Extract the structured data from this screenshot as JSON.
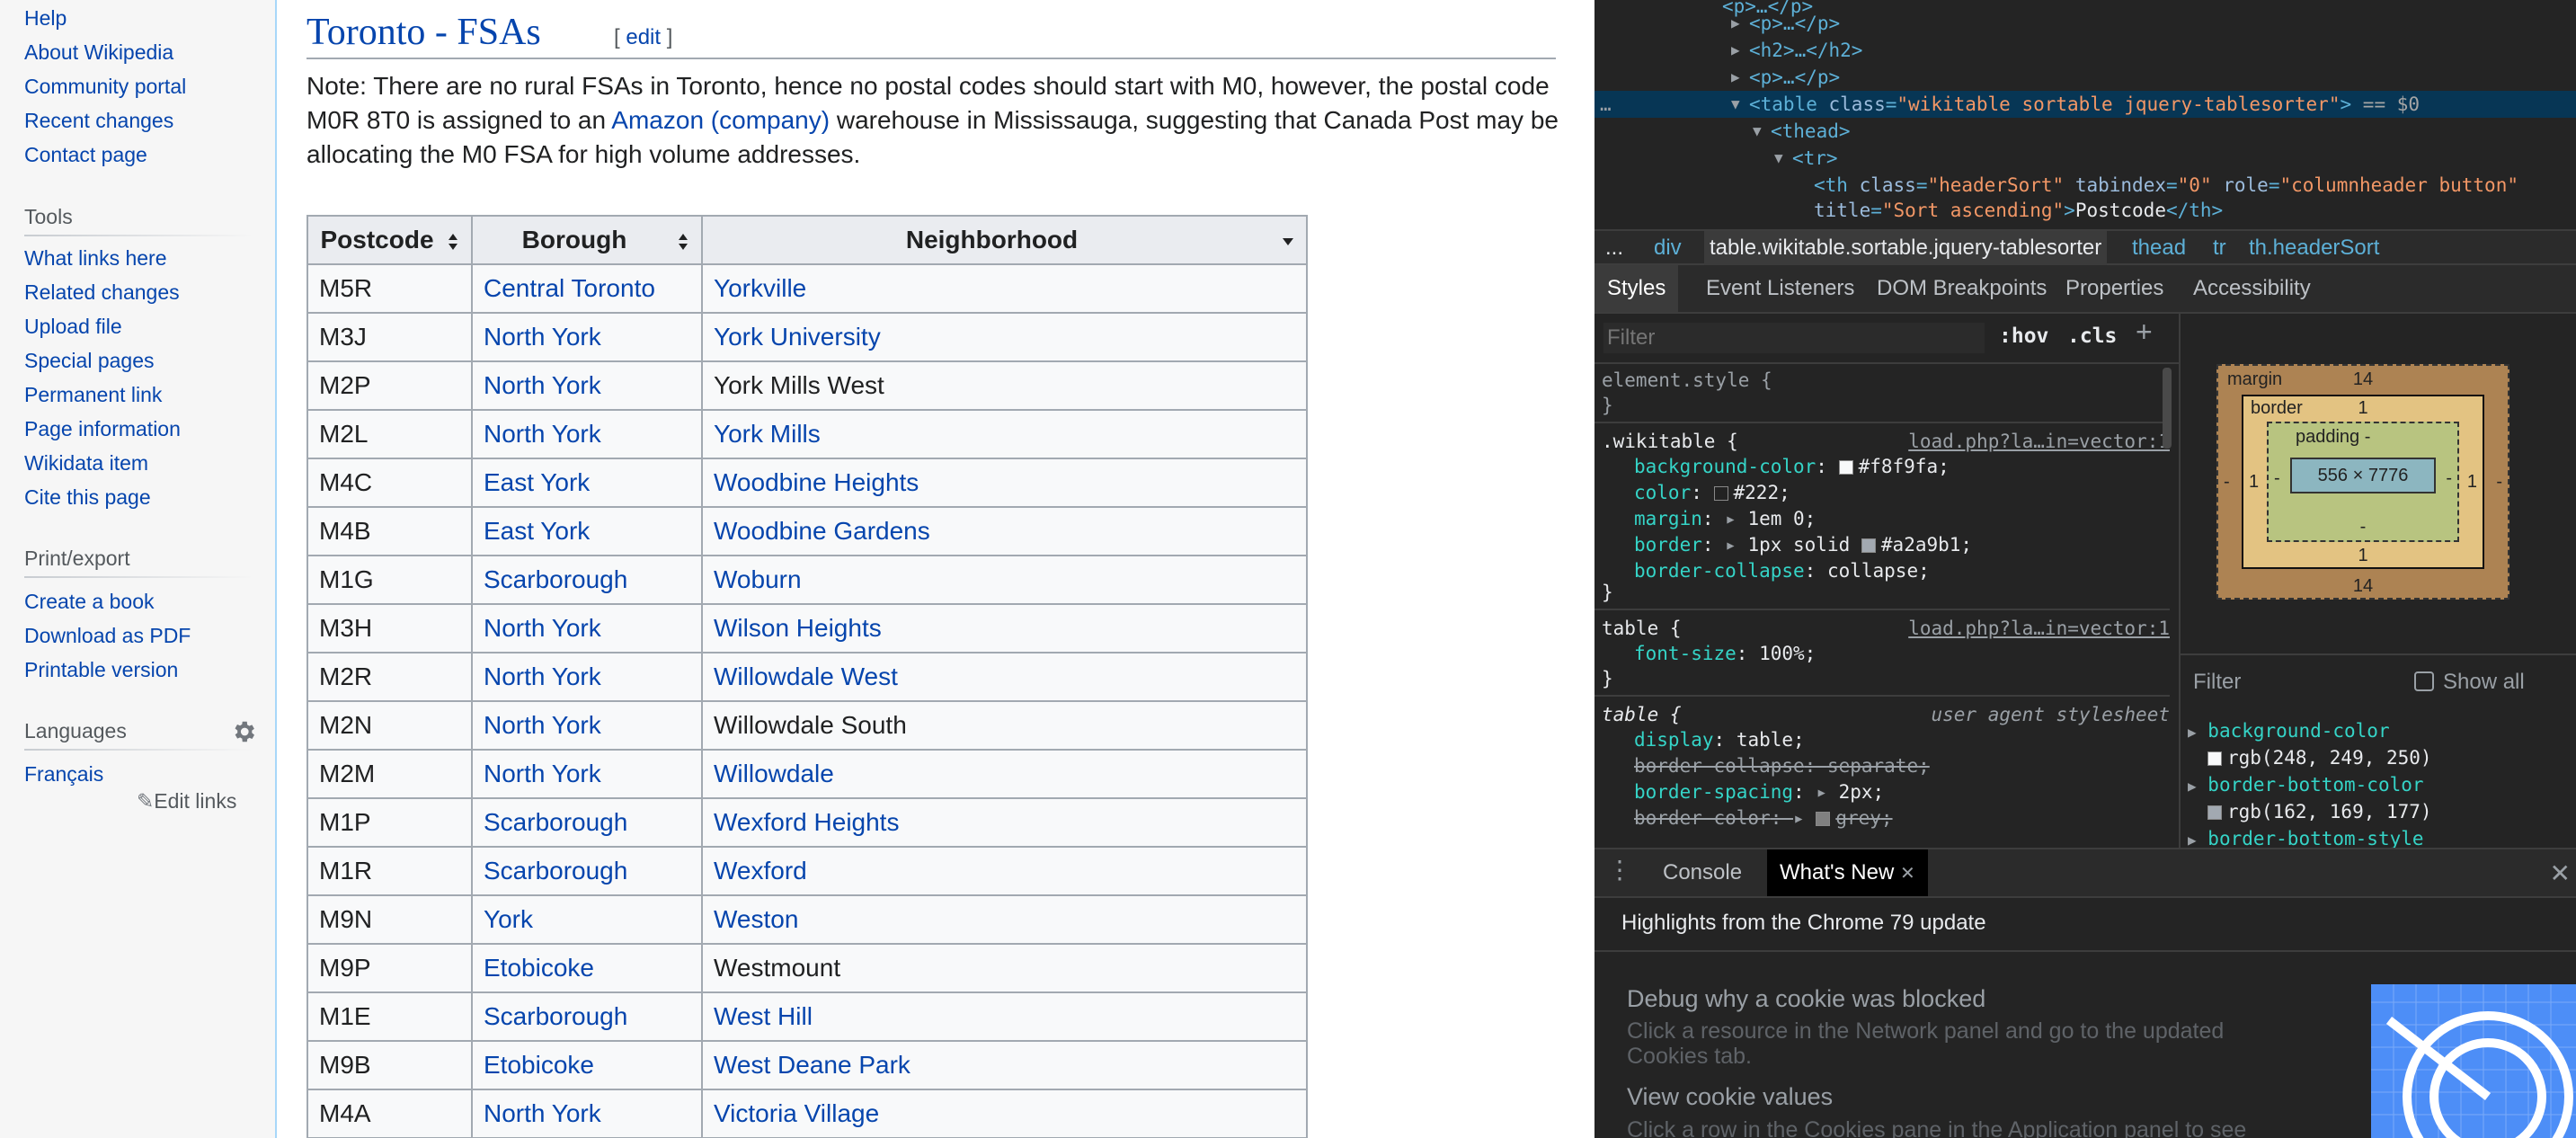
{
  "sidebar": {
    "links_top": [
      "Help",
      "About Wikipedia",
      "Community portal",
      "Recent changes",
      "Contact page"
    ],
    "tools_heading": "Tools",
    "tools": [
      "What links here",
      "Related changes",
      "Upload file",
      "Special pages",
      "Permanent link",
      "Page information",
      "Wikidata item",
      "Cite this page"
    ],
    "print_heading": "Print/export",
    "print": [
      "Create a book",
      "Download as PDF",
      "Printable version"
    ],
    "languages_heading": "Languages",
    "languages": [
      "Français"
    ],
    "edit_links": "Edit links"
  },
  "article": {
    "heading": "Toronto - FSAs",
    "edit_open": "[ ",
    "edit_label": "edit",
    "edit_close": " ]",
    "note_1": "Note: There are no rural FSAs in Toronto, hence no postal codes should start with M0, however, the postal code M0R 8T0 is assigned to an ",
    "note_link": "Amazon (company)",
    "note_2": " warehouse in Mississauga, suggesting that Canada Post may be allocating the M0 FSA for high volume addresses.",
    "columns": [
      "Postcode",
      "Borough",
      "Neighborhood"
    ],
    "rows": [
      {
        "postcode": "M5R",
        "borough": "Central Toronto",
        "neighborhood": "Yorkville",
        "n_link": true
      },
      {
        "postcode": "M3J",
        "borough": "North York",
        "neighborhood": "York University",
        "n_link": true
      },
      {
        "postcode": "M2P",
        "borough": "North York",
        "neighborhood": "York Mills West",
        "n_link": false
      },
      {
        "postcode": "M2L",
        "borough": "North York",
        "neighborhood": "York Mills",
        "n_link": true
      },
      {
        "postcode": "M4C",
        "borough": "East York",
        "neighborhood": "Woodbine Heights",
        "n_link": true
      },
      {
        "postcode": "M4B",
        "borough": "East York",
        "neighborhood": "Woodbine Gardens",
        "n_link": true
      },
      {
        "postcode": "M1G",
        "borough": "Scarborough",
        "neighborhood": "Woburn",
        "n_link": true
      },
      {
        "postcode": "M3H",
        "borough": "North York",
        "neighborhood": "Wilson Heights",
        "n_link": true
      },
      {
        "postcode": "M2R",
        "borough": "North York",
        "neighborhood": "Willowdale West",
        "n_link": true
      },
      {
        "postcode": "M2N",
        "borough": "North York",
        "neighborhood": "Willowdale South",
        "n_link": false
      },
      {
        "postcode": "M2M",
        "borough": "North York",
        "neighborhood": "Willowdale",
        "n_link": true
      },
      {
        "postcode": "M1P",
        "borough": "Scarborough",
        "neighborhood": "Wexford Heights",
        "n_link": true
      },
      {
        "postcode": "M1R",
        "borough": "Scarborough",
        "neighborhood": "Wexford",
        "n_link": true
      },
      {
        "postcode": "M9N",
        "borough": "York",
        "neighborhood": "Weston",
        "n_link": true
      },
      {
        "postcode": "M9P",
        "borough": "Etobicoke",
        "neighborhood": "Westmount",
        "n_link": false
      },
      {
        "postcode": "M1E",
        "borough": "Scarborough",
        "neighborhood": "West Hill",
        "n_link": true
      },
      {
        "postcode": "M9B",
        "borough": "Etobicoke",
        "neighborhood": "West Deane Park",
        "n_link": true
      },
      {
        "postcode": "M4A",
        "borough": "North York",
        "neighborhood": "Victoria Village",
        "n_link": true
      }
    ]
  },
  "devtools": {
    "dom": {
      "p1": "<p>…</p>",
      "h2": "<h2>…</h2>",
      "p2": "<p>…</p>",
      "sel_dots": "…",
      "sel_tag_open": "<table",
      "sel_attr": "class",
      "sel_val": "\"wikitable sortable jquery-tablesorter\"",
      "sel_close": ">",
      "sel_eq": "== $0",
      "thead": "<thead>",
      "tr": "<tr>",
      "th_open": "<th",
      "th_a1": "class",
      "th_v1": "\"headerSort\"",
      "th_a2": "tabindex",
      "th_v2": "\"0\"",
      "th_a3": "role",
      "th_v3": "\"columnheader button\"",
      "th_a4": "title",
      "th_v4": "\"Sort ascending\"",
      "th_text": "Postcode",
      "th_end": "</th>"
    },
    "breadcrumbs": [
      "...",
      "div",
      "table.wikitable.sortable.jquery-tablesorter",
      "thead",
      "tr",
      "th.headerSort"
    ],
    "tabs": [
      "Styles",
      "Event Listeners",
      "DOM Breakpoints",
      "Properties",
      "Accessibility"
    ],
    "filter_placeholder": "Filter",
    "hov": ":hov",
    "cls": ".cls",
    "plus": "+",
    "element_style": "element.style {",
    "close_brace": "}",
    "rule1": {
      "selector": ".wikitable",
      "open": " {",
      "source": "load.php?la…in=vector:1",
      "decls": [
        {
          "p": "background-color",
          "v": "#f8f9fa",
          "swatch": "#f8f9fa"
        },
        {
          "p": "color",
          "v": "#222",
          "swatch": "#222222"
        },
        {
          "p": "margin",
          "v": "1em 0",
          "tri": true
        },
        {
          "p": "border",
          "v": "1px solid",
          "tri": true,
          "swatch": "#a2a9b1",
          "v2": "#a2a9b1"
        },
        {
          "p": "border-collapse",
          "v": "collapse"
        }
      ]
    },
    "rule2": {
      "selector": "table",
      "open": " {",
      "source": "load.php?la…in=vector:1",
      "decls": [
        {
          "p": "font-size",
          "v": "100%"
        }
      ]
    },
    "rule3": {
      "selector": "table",
      "open": " {",
      "source": "user agent stylesheet",
      "decls": [
        {
          "p": "display",
          "v": "table"
        },
        {
          "p": "border-collapse",
          "v": "separate",
          "strike": true
        },
        {
          "p": "border-spacing",
          "v": "2px",
          "tri": true
        },
        {
          "p": "border-color",
          "v": "grey",
          "tri": true,
          "swatch": "#808080",
          "strike": true
        }
      ]
    },
    "box": {
      "margin_label": "margin",
      "margin_top": "14",
      "margin_bottom": "14",
      "margin_left": "-",
      "margin_right": "-",
      "border_label": "border",
      "border_top": "1",
      "border_bottom": "1",
      "border_left": "1",
      "border_right": "1",
      "padding_label": "padding -",
      "padding_bottom": "-",
      "padding_left": "-",
      "padding_right": "-",
      "content": "556 × 7776"
    },
    "computed": {
      "filter": "Filter",
      "show_all": "Show all",
      "items": [
        {
          "p": "background-color",
          "v": "rgb(248, 249, 250)",
          "swatch": "#f8f9fa"
        },
        {
          "p": "border-bottom-color",
          "v": "rgb(162, 169, 177)",
          "swatch": "#a2a9b1"
        },
        {
          "p": "border-bottom-style",
          "v": ""
        }
      ]
    },
    "drawer": {
      "tabs": [
        "Console",
        "What's New"
      ],
      "highlights": "Highlights from the Chrome 79 update",
      "items": [
        {
          "title": "Debug why a cookie was blocked",
          "desc": "Click a resource in the Network panel and go to the updated Cookies tab."
        },
        {
          "title": "View cookie values",
          "desc": "Click a row in the Cookies pane in the Application panel to see"
        }
      ]
    },
    "colors": {
      "link": "#0645ad",
      "selected_dom": "#073655",
      "accent": "#4d8ef7"
    }
  }
}
